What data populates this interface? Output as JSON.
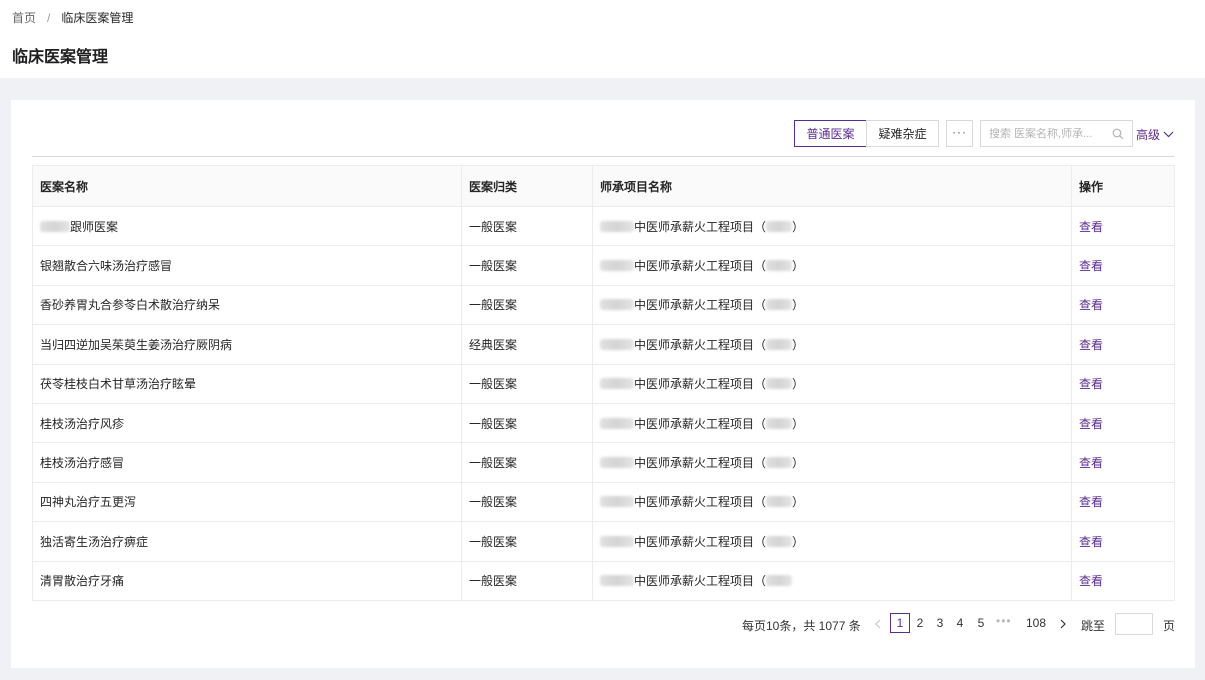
{
  "breadcrumb": {
    "home": "首页",
    "separator": "/",
    "current": "临床医案管理"
  },
  "page_title": "临床医案管理",
  "toolbar": {
    "tabs": [
      {
        "label": "普通医案",
        "active": true
      },
      {
        "label": "疑难杂症",
        "active": false
      }
    ],
    "more_label": "···",
    "search_placeholder": "搜索 医案名称,师承...",
    "advanced_label": "高级"
  },
  "table": {
    "columns": [
      "医案名称",
      "医案归类",
      "师承项目名称",
      "操作"
    ],
    "rows": [
      {
        "name_prefix": "",
        "name": "跟师医案",
        "category": "一般医案",
        "project": "中医师承薪火工程项目（",
        "project_end": "）",
        "action": "查看"
      },
      {
        "name_prefix": "",
        "name": "银翘散合六味汤治疗感冒",
        "category": "一般医案",
        "project": "中医师承薪火工程项目（",
        "project_end": "）",
        "action": "查看"
      },
      {
        "name_prefix": "",
        "name": "香砂养胃丸合参苓白术散治疗纳呆",
        "category": "一般医案",
        "project": "中医师承薪火工程项目（",
        "project_end": "）",
        "action": "查看"
      },
      {
        "name_prefix": "",
        "name": "当归四逆加吴茱萸生姜汤治疗厥阴病",
        "category": "经典医案",
        "project": "中医师承薪火工程项目（",
        "project_end": "）",
        "action": "查看"
      },
      {
        "name_prefix": "",
        "name": "茯苓桂枝白术甘草汤治疗眩晕",
        "category": "一般医案",
        "project": "中医师承薪火工程项目（",
        "project_end": "）",
        "action": "查看"
      },
      {
        "name_prefix": "",
        "name": "桂枝汤治疗风疹",
        "category": "一般医案",
        "project": "中医师承薪火工程项目（",
        "project_end": "）",
        "action": "查看"
      },
      {
        "name_prefix": "",
        "name": "桂枝汤治疗感冒",
        "category": "一般医案",
        "project": "中医师承薪火工程项目（",
        "project_end": "）",
        "action": "查看"
      },
      {
        "name_prefix": "",
        "name": "四神丸治疗五更泻",
        "category": "一般医案",
        "project": "中医师承薪火工程项目（",
        "project_end": "）",
        "action": "查看"
      },
      {
        "name_prefix": "",
        "name": "独活寄生汤治疗痹症",
        "category": "一般医案",
        "project": "中医师承薪火工程项目（",
        "project_end": "）",
        "action": "查看"
      },
      {
        "name_prefix": "",
        "name": "清胃散治疗牙痛",
        "category": "一般医案",
        "project": "中医师承薪火工程项目（",
        "project_end": "",
        "action": "查看"
      }
    ]
  },
  "pagination": {
    "total_text": "每页10条，共 1077 条",
    "pages": [
      "1",
      "2",
      "3",
      "4",
      "5"
    ],
    "current": "1",
    "ellipsis": "•••",
    "last_page": "108",
    "jump_label": "跳至",
    "jump_suffix": "页"
  },
  "colors": {
    "accent": "#5b2d90",
    "background": "#f0f1f4",
    "border": "#d9d9d9"
  }
}
